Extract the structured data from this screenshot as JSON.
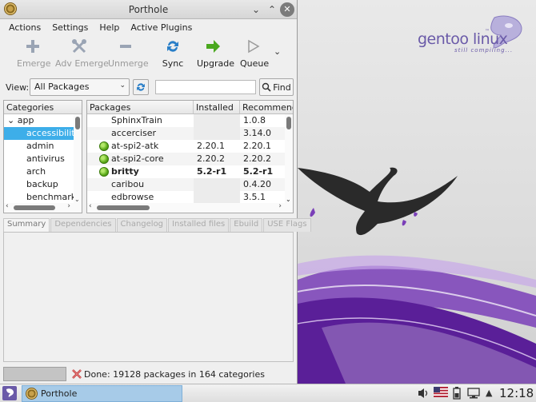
{
  "window": {
    "title": "Porthole",
    "controls": {
      "minimize": "⌄",
      "maximize": "⌃",
      "close": "✕"
    }
  },
  "menubar": [
    "Actions",
    "Settings",
    "Help",
    "Active Plugins"
  ],
  "toolbar": {
    "emerge": "Emerge",
    "adv_emerge": "Adv Emerge",
    "unmerge": "Unmerge",
    "sync": "Sync",
    "upgrade": "Upgrade",
    "queue": "Queue"
  },
  "view": {
    "label": "View:",
    "selected": "All Packages",
    "search_value": "",
    "find_label": "Find"
  },
  "categories": {
    "header": "Categories",
    "parent": "app",
    "items": [
      "accessibility",
      "admin",
      "antivirus",
      "arch",
      "backup",
      "benchmark"
    ],
    "selected": "accessibility"
  },
  "packages": {
    "headers": [
      "Packages",
      "Installed",
      "Recommended"
    ],
    "rows": [
      {
        "name": "SphinxTrain",
        "installed": "",
        "recommended": "1.0.8",
        "is_installed": false
      },
      {
        "name": "accerciser",
        "installed": "",
        "recommended": "3.14.0",
        "is_installed": false
      },
      {
        "name": "at-spi2-atk",
        "installed": "2.20.1",
        "recommended": "2.20.1",
        "is_installed": true
      },
      {
        "name": "at-spi2-core",
        "installed": "2.20.2",
        "recommended": "2.20.2",
        "is_installed": true
      },
      {
        "name": "britty",
        "installed": "5.2-r1",
        "recommended": "5.2-r1",
        "is_installed": true,
        "bold": true
      },
      {
        "name": "caribou",
        "installed": "",
        "recommended": "0.4.20",
        "is_installed": false
      },
      {
        "name": "edbrowse",
        "installed": "",
        "recommended": "3.5.1",
        "is_installed": false
      }
    ]
  },
  "tabs": [
    "Summary",
    "Dependencies",
    "Changelog",
    "Installed files",
    "Ebuild",
    "USE Flags"
  ],
  "status": {
    "text": "Done: 19128 packages in 164 categories"
  },
  "taskbar": {
    "task_label": "Porthole",
    "clock": "12:18"
  },
  "wallpaper": {
    "brand": "gentoo linux",
    "tagline": "still compiling...",
    "tm": "™"
  },
  "colors": {
    "selection": "#3daee9",
    "installed_dot": "#5cab1a",
    "gentoo_purple": "#6a5aa8"
  }
}
